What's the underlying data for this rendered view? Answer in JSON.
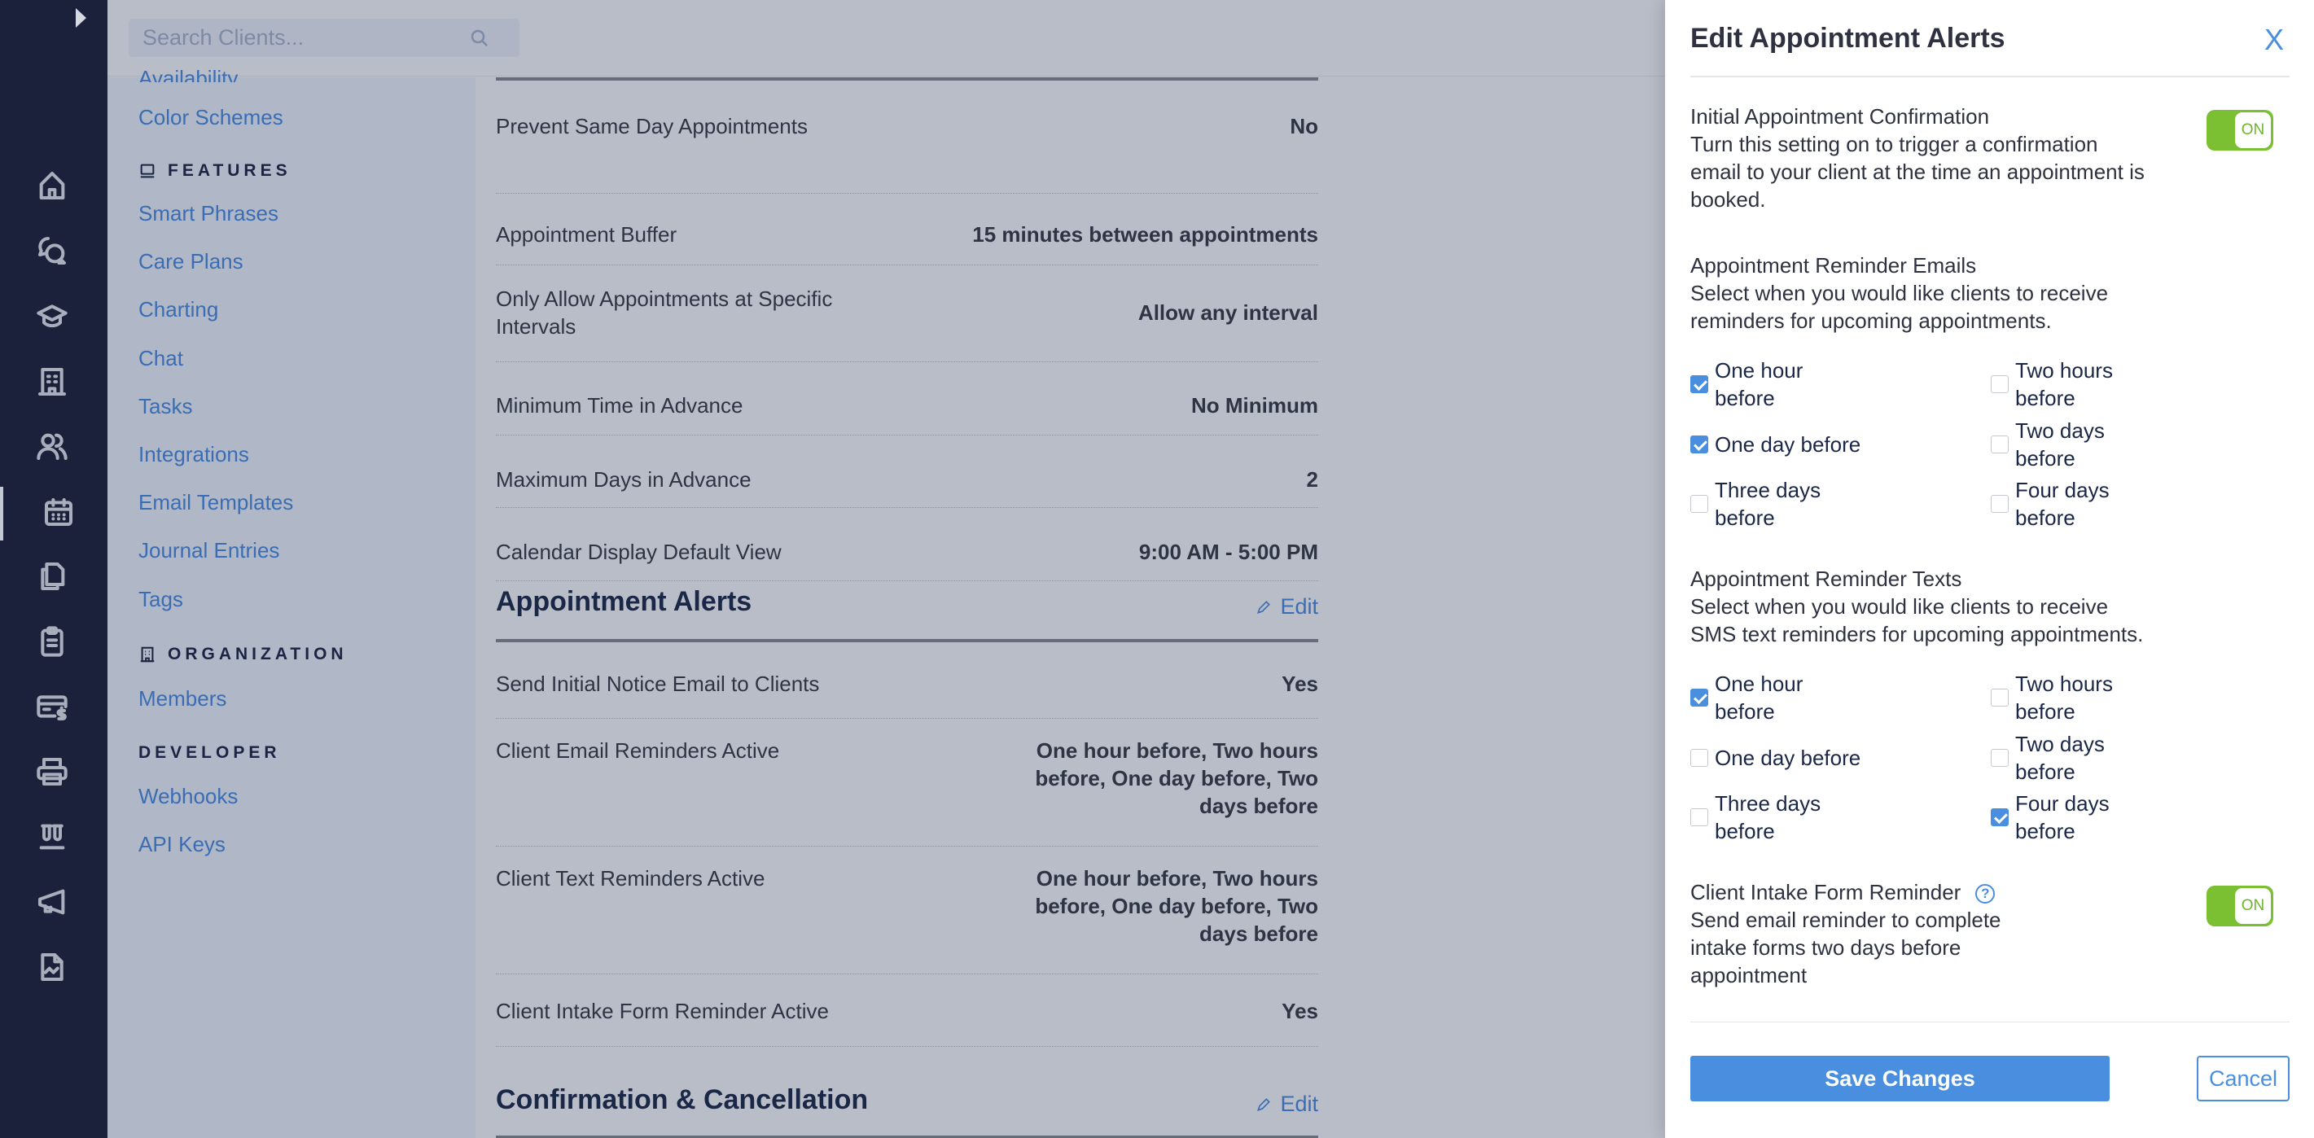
{
  "rail": {
    "expand_icon": "chevron-right-icon",
    "items": [
      {
        "icon": "home-icon"
      },
      {
        "icon": "chat-bubbles-icon"
      },
      {
        "icon": "graduation-cap-icon"
      },
      {
        "icon": "building-icon"
      },
      {
        "icon": "users-icon"
      },
      {
        "icon": "calendar-icon",
        "active": true
      },
      {
        "icon": "documents-icon"
      },
      {
        "icon": "clipboard-icon"
      },
      {
        "icon": "billing-card-icon"
      },
      {
        "icon": "printer-icon"
      },
      {
        "icon": "lab-tubes-icon"
      },
      {
        "icon": "megaphone-icon"
      },
      {
        "icon": "report-chart-icon"
      }
    ]
  },
  "search": {
    "placeholder": "Search Clients..."
  },
  "subnav": {
    "cut_item": "Availability",
    "items_top": [
      "Color Schemes"
    ],
    "features_heading": "FEATURES",
    "features": [
      "Smart Phrases",
      "Care Plans",
      "Charting",
      "Chat",
      "Tasks",
      "Integrations",
      "Email Templates",
      "Journal Entries",
      "Tags"
    ],
    "organization_heading": "ORGANIZATION",
    "organization": [
      "Members"
    ],
    "developer_heading": "DEVELOPER",
    "developer": [
      "Webhooks",
      "API Keys"
    ]
  },
  "main": {
    "calendar_rows": [
      {
        "label": "Prevent Same Day Appointments",
        "value": "No"
      },
      {
        "label": "Appointment Buffer",
        "value": "15 minutes between appointments"
      },
      {
        "label": "Only Allow Appointments at Specific Intervals",
        "value": "Allow any interval"
      },
      {
        "label": "Minimum Time in Advance",
        "value": "No Minimum"
      },
      {
        "label": "Maximum Days in Advance",
        "value": "2"
      },
      {
        "label": "Calendar Display Default View",
        "value": "9:00 AM - 5:00 PM"
      }
    ],
    "alerts_section": {
      "title": "Appointment Alerts",
      "edit_label": "Edit",
      "rows": [
        {
          "label": "Send Initial Notice Email to Clients",
          "value": "Yes"
        },
        {
          "label": "Client Email Reminders Active",
          "value": "One hour before, Two hours before, One day before, Two days before"
        },
        {
          "label": "Client Text Reminders Active",
          "value": "One hour before, Two hours before, One day before, Two days before"
        },
        {
          "label": "Client Intake Form Reminder Active",
          "value": "Yes"
        }
      ]
    },
    "confirmation_section": {
      "title": "Confirmation & Cancellation",
      "edit_label": "Edit"
    }
  },
  "drawer": {
    "title": "Edit Appointment Alerts",
    "close_label": "X",
    "initial_confirmation": {
      "title": "Initial Appointment Confirmation",
      "desc_lines": [
        "Turn this setting on to trigger a confirmation",
        "email to your client at the time an appointment is",
        "booked."
      ],
      "toggle_label": "ON",
      "enabled": true
    },
    "email_reminders": {
      "title": "Appointment Reminder Emails",
      "desc_lines": [
        "Select when you would like clients to receive",
        "reminders for upcoming appointments."
      ],
      "options": [
        {
          "lines": [
            "One hour",
            "before"
          ],
          "checked": true
        },
        {
          "lines": [
            "Two hours",
            "before"
          ],
          "checked": false
        },
        {
          "lines": [
            "One day before"
          ],
          "checked": true
        },
        {
          "lines": [
            "Two days",
            "before"
          ],
          "checked": false
        },
        {
          "lines": [
            "Three days",
            "before"
          ],
          "checked": false
        },
        {
          "lines": [
            "Four days",
            "before"
          ],
          "checked": false
        }
      ]
    },
    "text_reminders": {
      "title": "Appointment Reminder Texts",
      "desc_lines": [
        "Select when you would like clients to receive",
        "SMS text reminders for upcoming appointments."
      ],
      "options": [
        {
          "lines": [
            "One hour",
            "before"
          ],
          "checked": true
        },
        {
          "lines": [
            "Two hours",
            "before"
          ],
          "checked": false
        },
        {
          "lines": [
            "One day before"
          ],
          "checked": false
        },
        {
          "lines": [
            "Two days",
            "before"
          ],
          "checked": false
        },
        {
          "lines": [
            "Three days",
            "before"
          ],
          "checked": false
        },
        {
          "lines": [
            "Four days",
            "before"
          ],
          "checked": true
        }
      ]
    },
    "intake_reminder": {
      "title": "Client Intake Form Reminder",
      "help_label": "?",
      "desc_lines": [
        "Send email reminder to complete",
        "intake forms two days before",
        "appointment"
      ],
      "toggle_label": "ON",
      "enabled": true
    },
    "save_label": "Save Changes",
    "cancel_label": "Cancel"
  },
  "colors": {
    "accent": "#4a8ee0",
    "link": "#3a6db3",
    "toggle_on": "#7bbf33",
    "rail_bg": "#1b213b"
  }
}
